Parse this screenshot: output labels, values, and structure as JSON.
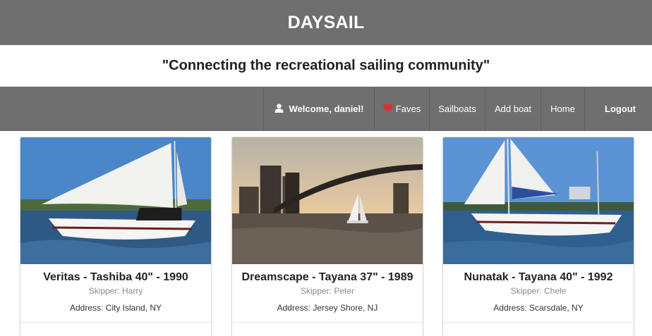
{
  "header": {
    "brand": "DAYSAIL"
  },
  "tagline": "\"Connecting the recreational sailing community\"",
  "nav": {
    "welcome": "Welcome, daniel!",
    "faves": "Faves",
    "sailboats": "Sailboats",
    "add_boat": "Add boat",
    "home": "Home",
    "logout": "Logout"
  },
  "colors": {
    "bar": "#6f6f6f",
    "heart": "#d9302f"
  },
  "boats": [
    {
      "title": "Veritas - Tashiba 40\" - 1990",
      "skipper": "Skipper: Harry",
      "address": "Address: City Island, NY",
      "image": "sailboat-photo"
    },
    {
      "title": "Dreamscape - Tayana 37\" - 1989",
      "skipper": "Skipper: Peter",
      "address": "Address: Jersey Shore, NJ",
      "image": "city-bridge-photo"
    },
    {
      "title": "Nunatak - Tayana 40\" - 1992",
      "skipper": "Skipper: Chele",
      "address": "Address: Scarsdale, NY",
      "image": "sailboat-photo"
    }
  ]
}
